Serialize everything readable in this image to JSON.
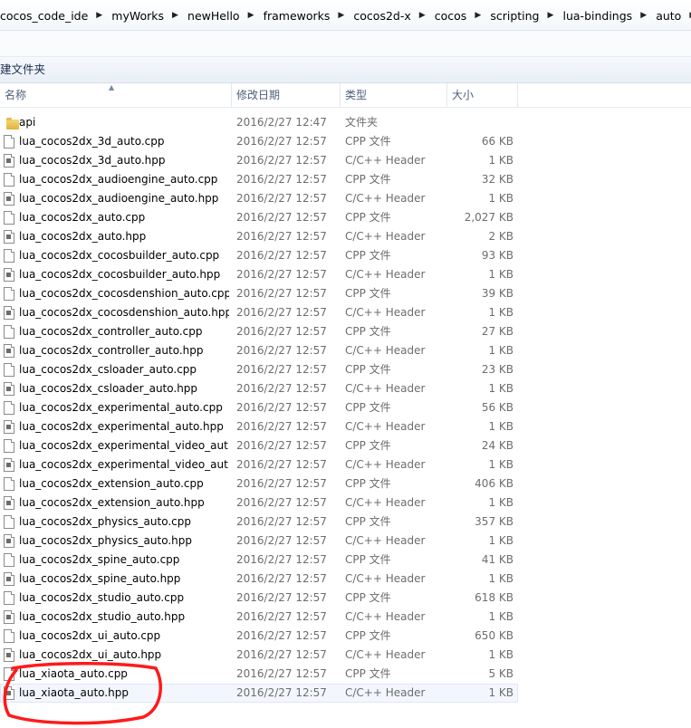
{
  "breadcrumb": [
    "cocos_code_ide",
    "myWorks",
    "newHello",
    "frameworks",
    "cocos2d-x",
    "cocos",
    "scripting",
    "lua-bindings",
    "auto"
  ],
  "toolbar": {
    "new_folder_label": "建文件夹"
  },
  "columns": {
    "name": "名称",
    "date": "修改日期",
    "type": "类型",
    "size": "大小"
  },
  "files": [
    {
      "name": "api",
      "date": "2016/2/27 12:47",
      "type": "文件夹",
      "size": "",
      "icon": "folder-icon"
    },
    {
      "name": "lua_cocos2dx_3d_auto.cpp",
      "date": "2016/2/27 12:57",
      "type": "CPP 文件",
      "size": "66 KB",
      "icon": "cpp-file-icon"
    },
    {
      "name": "lua_cocos2dx_3d_auto.hpp",
      "date": "2016/2/27 12:57",
      "type": "C/C++ Header",
      "size": "1 KB",
      "icon": "header-file-icon"
    },
    {
      "name": "lua_cocos2dx_audioengine_auto.cpp",
      "date": "2016/2/27 12:57",
      "type": "CPP 文件",
      "size": "32 KB",
      "icon": "cpp-file-icon"
    },
    {
      "name": "lua_cocos2dx_audioengine_auto.hpp",
      "date": "2016/2/27 12:57",
      "type": "C/C++ Header",
      "size": "1 KB",
      "icon": "header-file-icon"
    },
    {
      "name": "lua_cocos2dx_auto.cpp",
      "date": "2016/2/27 12:57",
      "type": "CPP 文件",
      "size": "2,027 KB",
      "icon": "cpp-file-icon"
    },
    {
      "name": "lua_cocos2dx_auto.hpp",
      "date": "2016/2/27 12:57",
      "type": "C/C++ Header",
      "size": "2 KB",
      "icon": "header-file-icon"
    },
    {
      "name": "lua_cocos2dx_cocosbuilder_auto.cpp",
      "date": "2016/2/27 12:57",
      "type": "CPP 文件",
      "size": "93 KB",
      "icon": "cpp-file-icon"
    },
    {
      "name": "lua_cocos2dx_cocosbuilder_auto.hpp",
      "date": "2016/2/27 12:57",
      "type": "C/C++ Header",
      "size": "1 KB",
      "icon": "header-file-icon"
    },
    {
      "name": "lua_cocos2dx_cocosdenshion_auto.cpp",
      "date": "2016/2/27 12:57",
      "type": "CPP 文件",
      "size": "39 KB",
      "icon": "cpp-file-icon"
    },
    {
      "name": "lua_cocos2dx_cocosdenshion_auto.hpp",
      "date": "2016/2/27 12:57",
      "type": "C/C++ Header",
      "size": "1 KB",
      "icon": "header-file-icon"
    },
    {
      "name": "lua_cocos2dx_controller_auto.cpp",
      "date": "2016/2/27 12:57",
      "type": "CPP 文件",
      "size": "27 KB",
      "icon": "cpp-file-icon"
    },
    {
      "name": "lua_cocos2dx_controller_auto.hpp",
      "date": "2016/2/27 12:57",
      "type": "C/C++ Header",
      "size": "1 KB",
      "icon": "header-file-icon"
    },
    {
      "name": "lua_cocos2dx_csloader_auto.cpp",
      "date": "2016/2/27 12:57",
      "type": "CPP 文件",
      "size": "23 KB",
      "icon": "cpp-file-icon"
    },
    {
      "name": "lua_cocos2dx_csloader_auto.hpp",
      "date": "2016/2/27 12:57",
      "type": "C/C++ Header",
      "size": "1 KB",
      "icon": "header-file-icon"
    },
    {
      "name": "lua_cocos2dx_experimental_auto.cpp",
      "date": "2016/2/27 12:57",
      "type": "CPP 文件",
      "size": "56 KB",
      "icon": "cpp-file-icon"
    },
    {
      "name": "lua_cocos2dx_experimental_auto.hpp",
      "date": "2016/2/27 12:57",
      "type": "C/C++ Header",
      "size": "1 KB",
      "icon": "header-file-icon"
    },
    {
      "name": "lua_cocos2dx_experimental_video_aut...",
      "date": "2016/2/27 12:57",
      "type": "CPP 文件",
      "size": "24 KB",
      "icon": "cpp-file-icon"
    },
    {
      "name": "lua_cocos2dx_experimental_video_aut...",
      "date": "2016/2/27 12:57",
      "type": "C/C++ Header",
      "size": "1 KB",
      "icon": "header-file-icon"
    },
    {
      "name": "lua_cocos2dx_extension_auto.cpp",
      "date": "2016/2/27 12:57",
      "type": "CPP 文件",
      "size": "406 KB",
      "icon": "cpp-file-icon"
    },
    {
      "name": "lua_cocos2dx_extension_auto.hpp",
      "date": "2016/2/27 12:57",
      "type": "C/C++ Header",
      "size": "1 KB",
      "icon": "header-file-icon"
    },
    {
      "name": "lua_cocos2dx_physics_auto.cpp",
      "date": "2016/2/27 12:57",
      "type": "CPP 文件",
      "size": "357 KB",
      "icon": "cpp-file-icon"
    },
    {
      "name": "lua_cocos2dx_physics_auto.hpp",
      "date": "2016/2/27 12:57",
      "type": "C/C++ Header",
      "size": "1 KB",
      "icon": "header-file-icon"
    },
    {
      "name": "lua_cocos2dx_spine_auto.cpp",
      "date": "2016/2/27 12:57",
      "type": "CPP 文件",
      "size": "41 KB",
      "icon": "cpp-file-icon"
    },
    {
      "name": "lua_cocos2dx_spine_auto.hpp",
      "date": "2016/2/27 12:57",
      "type": "C/C++ Header",
      "size": "1 KB",
      "icon": "header-file-icon"
    },
    {
      "name": "lua_cocos2dx_studio_auto.cpp",
      "date": "2016/2/27 12:57",
      "type": "CPP 文件",
      "size": "618 KB",
      "icon": "cpp-file-icon"
    },
    {
      "name": "lua_cocos2dx_studio_auto.hpp",
      "date": "2016/2/27 12:57",
      "type": "C/C++ Header",
      "size": "1 KB",
      "icon": "header-file-icon"
    },
    {
      "name": "lua_cocos2dx_ui_auto.cpp",
      "date": "2016/2/27 12:57",
      "type": "CPP 文件",
      "size": "650 KB",
      "icon": "cpp-file-icon"
    },
    {
      "name": "lua_cocos2dx_ui_auto.hpp",
      "date": "2016/2/27 12:57",
      "type": "C/C++ Header",
      "size": "1 KB",
      "icon": "header-file-icon"
    },
    {
      "name": "lua_xiaota_auto.cpp",
      "date": "2016/2/27 12:57",
      "type": "CPP 文件",
      "size": "5 KB",
      "icon": "cpp-file-icon"
    },
    {
      "name": "lua_xiaota_auto.hpp",
      "date": "2016/2/27 12:57",
      "type": "C/C++ Header",
      "size": "1 KB",
      "icon": "header-file-icon"
    }
  ],
  "colors": {
    "annotation": "#ff1a1a",
    "header_text": "#4c607a",
    "meta_text": "#6d6d6d"
  }
}
